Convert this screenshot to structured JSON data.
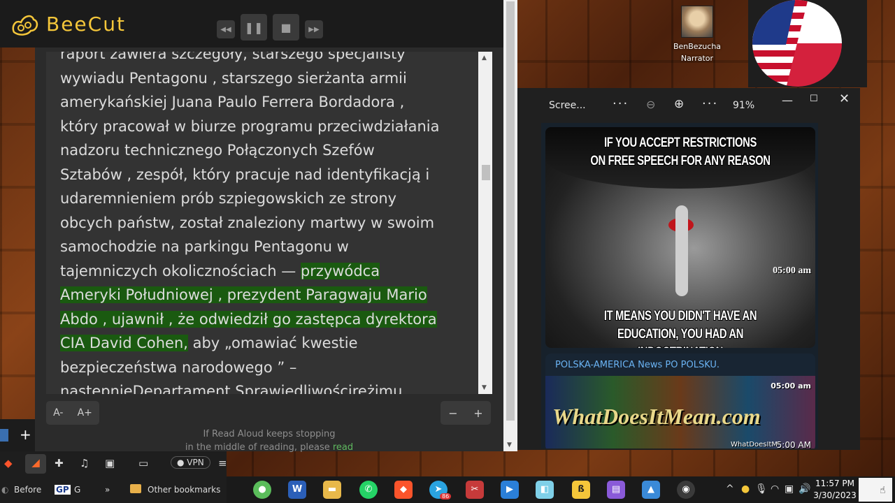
{
  "app": {
    "name": "BeeCut"
  },
  "player": {
    "rewind_icon": "rewind-icon",
    "pause_icon": "pause-icon",
    "stop_icon": "stop-icon",
    "forward_icon": "fast-forward-icon"
  },
  "reader": {
    "lines": [
      {
        "segments": [
          {
            "text": "raport zawiera szczegóły, starszego specjalisty",
            "hl": false
          }
        ]
      },
      {
        "segments": [
          {
            "text": "wywiadu Pentagonu , starszego sierżanta armii",
            "hl": false
          }
        ]
      },
      {
        "segments": [
          {
            "text": "amerykańskiej Juana Paulo Ferrera Bordadora ,",
            "hl": false
          }
        ]
      },
      {
        "segments": [
          {
            "text": "który pracował w biurze programu przeciwdziałania",
            "hl": false
          }
        ]
      },
      {
        "segments": [
          {
            "text": "nadzoru technicznego Połączonych Szefów",
            "hl": false
          }
        ]
      },
      {
        "segments": [
          {
            "text": "Sztabów , zespół, który pracuje nad identyfikacją i",
            "hl": false
          }
        ]
      },
      {
        "segments": [
          {
            "text": "udaremnieniem prób szpiegowskich ze strony",
            "hl": false
          }
        ]
      },
      {
        "segments": [
          {
            "text": "obcych państw, został znaleziony martwy w swoim",
            "hl": false
          }
        ]
      },
      {
        "segments": [
          {
            "text": "samochodzie na parkingu Pentagonu w",
            "hl": false
          }
        ]
      },
      {
        "segments": [
          {
            "text": "tajemniczych okolicznościach — ",
            "hl": false
          },
          {
            "text": "przywódca",
            "hl": true
          }
        ]
      },
      {
        "segments": [
          {
            "text": "Ameryki Południowej , prezydent Paragwaju Mario",
            "hl": true
          }
        ]
      },
      {
        "segments": [
          {
            "text": "Abdo , ujawnił , że odwiedził go zastępca dyrektora",
            "hl": true
          }
        ]
      },
      {
        "segments": [
          {
            "text": "CIA David Cohen,",
            "hl": true
          },
          {
            "text": " aby „omawiać kwestie",
            "hl": false
          }
        ]
      },
      {
        "segments": [
          {
            "text": "bezpieczeństwa narodowego ” –",
            "hl": false
          }
        ]
      },
      {
        "segments": [
          {
            "text": "następnieDepartament Sprawiedliwościreżimu",
            "hl": false
          }
        ]
      }
    ],
    "font_decrease": "A-",
    "font_increase": "A+",
    "speed_decrease": "−",
    "speed_increase": "+",
    "note_line1": "If Read Aloud keeps stopping",
    "note_line2": "in the middle of reading, please",
    "note_link": "read"
  },
  "narrator": {
    "name": "BenBezucha",
    "role": "Narrator"
  },
  "viewer": {
    "title": "Scree...",
    "zoom": "91%",
    "meme_top": "IF YOU ACCEPT RESTRICTIONS\nON FREE SPEECH FOR ANY REASON",
    "meme_bottom": "IT MEANS YOU DIDN'T HAVE AN\nEDUCATION, YOU HAD AN INDOCTRINATION",
    "meme_time": "05:00 am",
    "channel": "POLSKA-AMERICA News PO POLSKU.",
    "card_time_top": "05:00 am",
    "watermark": "WhatDoesItMean.com",
    "card_site": "WhatDoesItM",
    "card_time_bottom": "5:00 AM"
  },
  "browser": {
    "vpn_label": "VPN",
    "bookmark_before": "Before",
    "bookmark_gp": "GP",
    "bookmark_g": "G",
    "more": "»",
    "other_bookmarks": "Other bookmarks"
  },
  "taskbar": {
    "word": "W",
    "telegram_badge": "86",
    "time": "11:57 PM",
    "date": "3/30/2023"
  }
}
